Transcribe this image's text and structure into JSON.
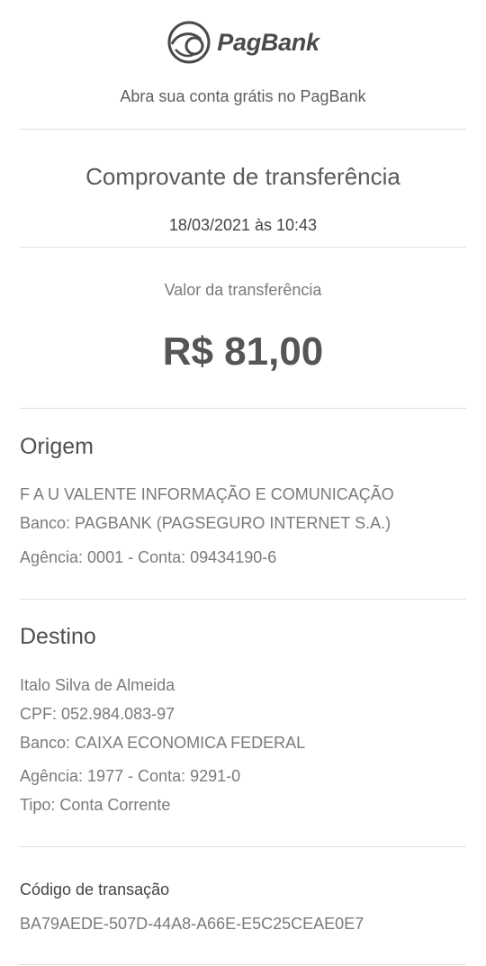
{
  "brand": {
    "name": "PagBank",
    "icon": "pagbank-logo-icon",
    "tagline": "Abra sua conta grátis no PagBank"
  },
  "receipt": {
    "title": "Comprovante de transferência",
    "datetime": "18/03/2021 às 10:43",
    "value_label": "Valor da transferência",
    "value": "R$ 81,00"
  },
  "origin": {
    "heading": "Origem",
    "name": "F A U VALENTE INFORMAÇÃO E COMUNICAÇÃO",
    "bank": "Banco: PAGBANK (PAGSEGURO INTERNET S.A.)",
    "account": "Agência: 0001 - Conta: 09434190-6"
  },
  "destination": {
    "heading": "Destino",
    "name": "Italo Silva de Almeida",
    "cpf": "CPF: 052.984.083-97",
    "bank": "Banco: CAIXA ECONOMICA FEDERAL",
    "account": "Agência: 1977 - Conta: 9291-0",
    "type": "Tipo: Conta Corrente"
  },
  "transaction": {
    "label": "Código de transação",
    "code": "BA79AEDE-507D-44A8-A66E-E5C25CEAE0E7"
  }
}
